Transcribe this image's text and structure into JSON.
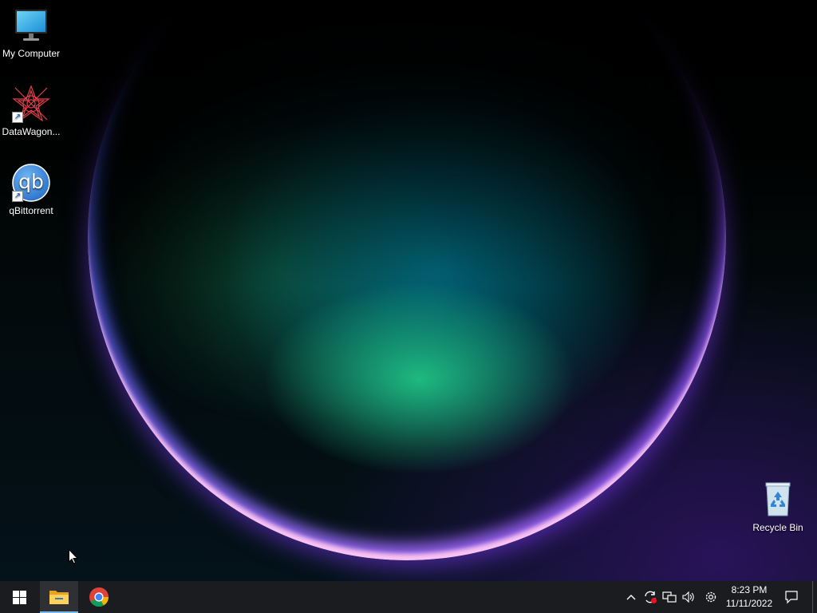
{
  "desktop": {
    "icons": [
      {
        "label": "My Computer",
        "icon": "monitor-icon"
      },
      {
        "label": "DataWagon...",
        "icon": "datawagon-icon",
        "shortcut": true
      },
      {
        "label": "qBittorrent",
        "icon": "qbittorrent-icon",
        "shortcut": true,
        "glyph_text": "qb"
      },
      {
        "label": "Recycle Bin",
        "icon": "recycle-bin-icon"
      }
    ]
  },
  "taskbar": {
    "start_icon": "windows-logo-icon",
    "pinned": [
      {
        "name": "File Explorer",
        "icon": "folder-icon",
        "active": true
      },
      {
        "name": "Google Chrome",
        "icon": "chrome-icon",
        "active": false
      }
    ],
    "tray": {
      "chevron": "^",
      "icons": [
        "sync-icon",
        "network-icon",
        "volume-icon",
        "gear-icon"
      ]
    },
    "clock": {
      "time": "8:23 PM",
      "date": "11/11/2022"
    },
    "notification_icon": "notification-icon"
  },
  "colors": {
    "taskbar_bg": "#1b1c1f",
    "accent": "#76b9ed"
  }
}
